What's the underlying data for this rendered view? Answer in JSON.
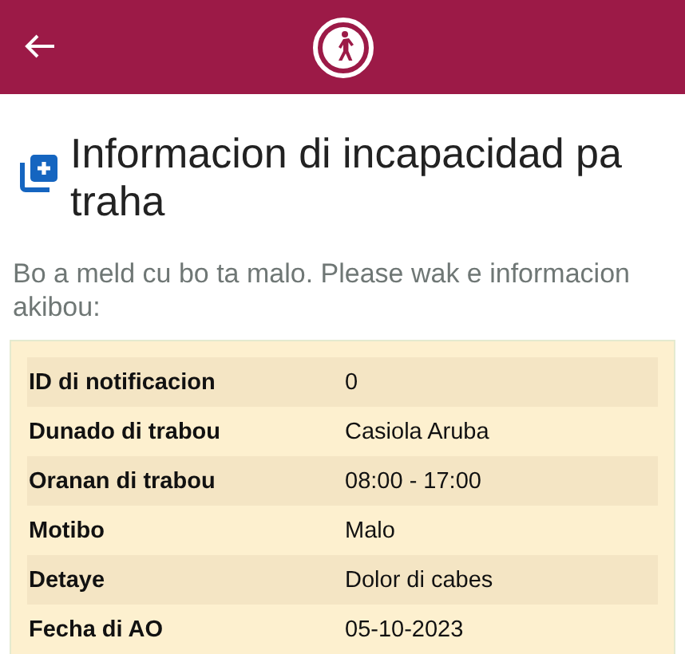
{
  "title": "Informacion di incapacidad pa traha",
  "subtitle": "Bo a meld cu bo ta malo. Please wak e informacion akibou:",
  "details": [
    {
      "label": "ID di notificacion",
      "value": "0"
    },
    {
      "label": "Dunado di trabou",
      "value": "Casiola Aruba"
    },
    {
      "label": "Oranan di trabou",
      "value": "08:00 - 17:00"
    },
    {
      "label": "Motibo",
      "value": "Malo"
    },
    {
      "label": "Detaye",
      "value": "Dolor di cabes"
    },
    {
      "label": "Fecha di AO",
      "value": "05-10-2023"
    }
  ]
}
